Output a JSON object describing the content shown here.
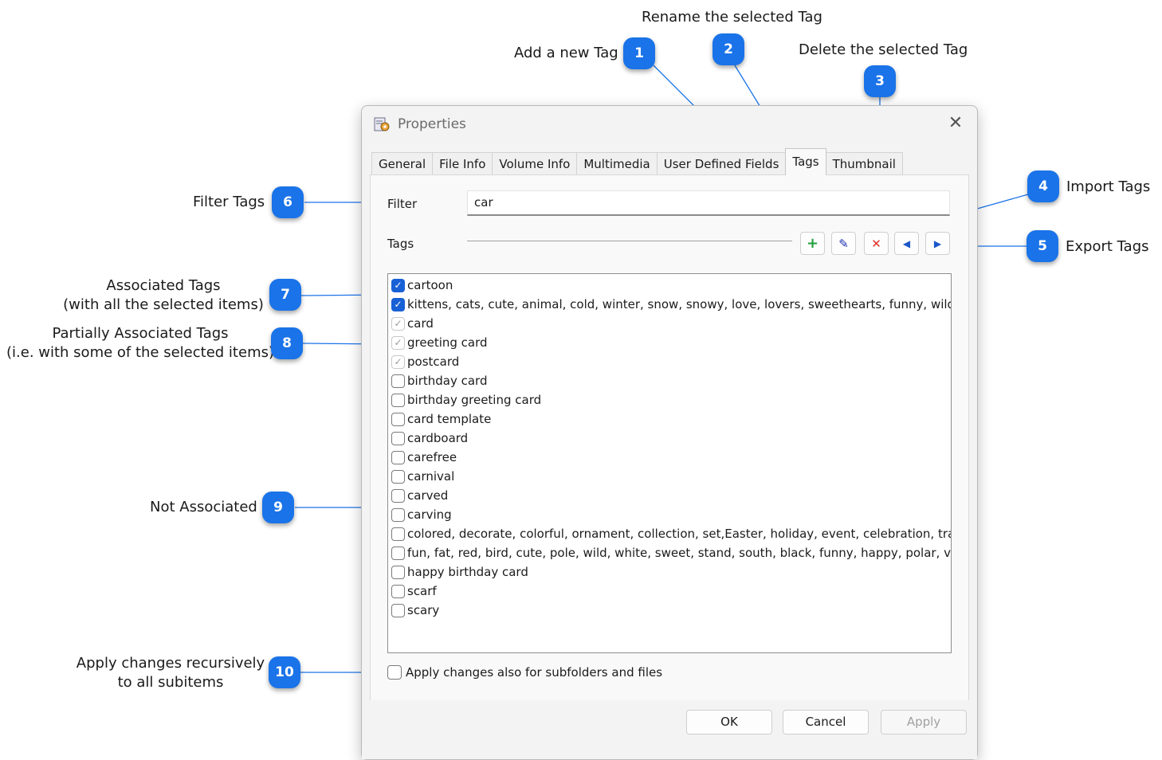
{
  "annotations": {
    "add": "Add a new Tag",
    "rename": "Rename the selected Tag",
    "delete": "Delete the selected Tag",
    "import": "Import Tags",
    "export": "Export Tags",
    "filter": "Filter Tags",
    "associated_1": "Associated Tags",
    "associated_2": "(with all the selected items)",
    "partial_1": "Partially Associated Tags",
    "partial_2": "(i.e. with some of the selected items)",
    "not_associated": "Not Associated",
    "recursive_1": "Apply changes recursively",
    "recursive_2": "to all subitems"
  },
  "badges": [
    "1",
    "2",
    "3",
    "4",
    "5",
    "6",
    "7",
    "8",
    "9",
    "10"
  ],
  "dialog": {
    "title": "Properties",
    "close_glyph": "✕",
    "tabs": [
      "General",
      "File Info",
      "Volume Info",
      "Multimedia",
      "User Defined Fields",
      "Tags",
      "Thumbnail"
    ],
    "active_tab": "Tags",
    "filter_label": "Filter",
    "filter_value": "car",
    "tags_label": "Tags",
    "toolbar": {
      "add": "+",
      "rename": "✎",
      "delete": "✕",
      "import": "◀",
      "export": "▶"
    },
    "tags": [
      {
        "label": "cartoon",
        "state": "checked"
      },
      {
        "label": "kittens, cats, cute, animal, cold, winter, snow, snowy, love, lovers, sweethearts, funny, wildli",
        "state": "checked"
      },
      {
        "label": "card",
        "state": "partial"
      },
      {
        "label": "greeting card",
        "state": "partial"
      },
      {
        "label": "postcard",
        "state": "partial"
      },
      {
        "label": "birthday card",
        "state": "unchecked"
      },
      {
        "label": "birthday greeting card",
        "state": "unchecked"
      },
      {
        "label": "card template",
        "state": "unchecked"
      },
      {
        "label": "cardboard",
        "state": "unchecked"
      },
      {
        "label": "carefree",
        "state": "unchecked"
      },
      {
        "label": "carnival",
        "state": "unchecked"
      },
      {
        "label": "carved",
        "state": "unchecked"
      },
      {
        "label": "carving",
        "state": "unchecked"
      },
      {
        "label": "colored, decorate, colorful, ornament, collection, set,Easter, holiday, event, celebration, trad",
        "state": "unchecked"
      },
      {
        "label": "fun, fat, red, bird, cute, pole, wild, white, sweet, stand, south, black, funny,  happy, polar, v",
        "state": "unchecked"
      },
      {
        "label": "happy birthday card",
        "state": "unchecked"
      },
      {
        "label": "scarf",
        "state": "unchecked"
      },
      {
        "label": "scary",
        "state": "unchecked"
      }
    ],
    "apply_recursive_label": "Apply changes also for subfolders and files",
    "buttons": {
      "ok": "OK",
      "cancel": "Cancel",
      "apply": "Apply"
    }
  },
  "colors": {
    "badge": "#1a73e8",
    "checkbox": "#1860d6",
    "leader": "#1a73e8",
    "add": "#1e9e3a",
    "delete": "#e0302a",
    "nav": "#1a56c8"
  }
}
